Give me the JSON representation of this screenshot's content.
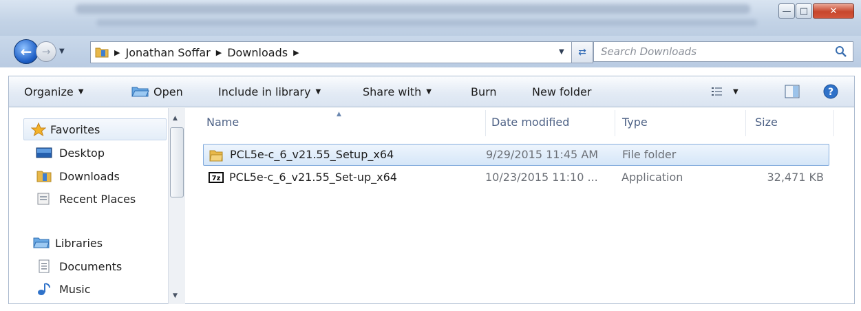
{
  "address": {
    "crumbs": [
      "Jonathan Soffar",
      "Downloads"
    ]
  },
  "search": {
    "placeholder": "Search Downloads"
  },
  "toolbar": {
    "organize": "Organize",
    "open": "Open",
    "include_in_library": "Include in library",
    "share_with": "Share with",
    "burn": "Burn",
    "new_folder": "New folder"
  },
  "nav": {
    "favorites": "Favorites",
    "desktop": "Desktop",
    "downloads": "Downloads",
    "recent_places": "Recent Places",
    "libraries": "Libraries",
    "documents": "Documents",
    "music": "Music"
  },
  "columns": {
    "name": "Name",
    "date": "Date modified",
    "type": "Type",
    "size": "Size"
  },
  "files": [
    {
      "name": "PCL5e-c_6_v21.55_Setup_x64",
      "date": "9/29/2015 11:45 AM",
      "type": "File folder",
      "size": "",
      "icon": "folder-icon",
      "selected": true
    },
    {
      "name": "PCL5e-c_6_v21.55_Set-up_x64",
      "date": "10/23/2015 11:10 ...",
      "type": "Application",
      "size": "32,471 KB",
      "icon": "7zip-icon",
      "selected": false
    }
  ],
  "colors": {
    "accent": "#2c67b4",
    "selection": "#d5e6f8",
    "header_text": "#4d6185"
  }
}
